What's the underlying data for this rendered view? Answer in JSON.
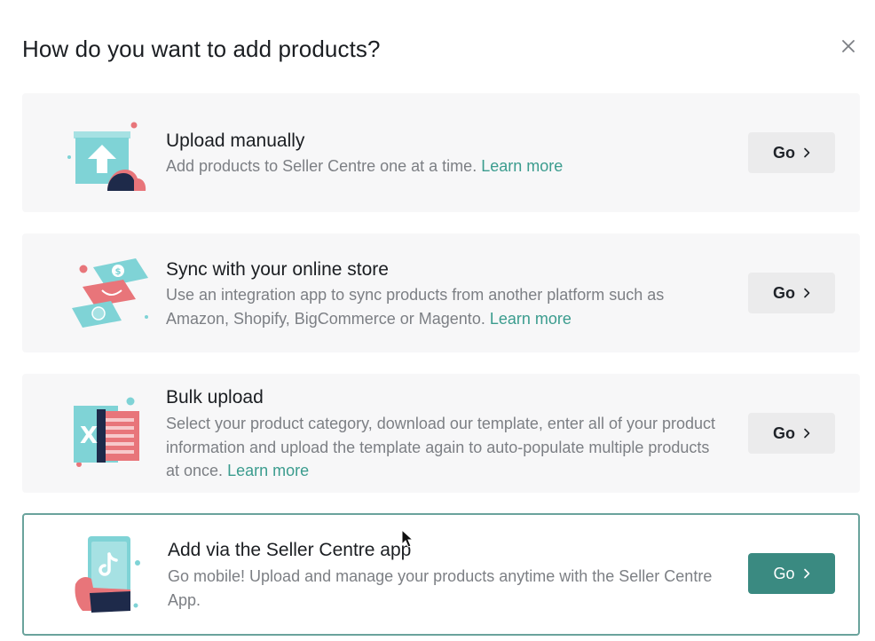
{
  "dialog": {
    "title": "How do you want to add products?",
    "close_icon": "close-icon"
  },
  "options": [
    {
      "title": "Upload manually",
      "description": "Add products to Seller Centre one at a time.",
      "link": "Learn more",
      "button": "Go",
      "icon": "upload-box-illustration"
    },
    {
      "title": "Sync with your online store",
      "description": "Use an integration app to sync products from another platform such as Amazon, Shopify, BigCommerce or Magento.",
      "link": "Learn more",
      "button": "Go",
      "icon": "sync-store-illustration"
    },
    {
      "title": "Bulk upload",
      "description": "Select your product category, download our template, enter all of your product information and upload the template again to auto-populate multiple products at once.",
      "link": "Learn more",
      "button": "Go",
      "icon": "spreadsheet-illustration"
    },
    {
      "title": "Add via the Seller Centre app",
      "description": "Go mobile! Upload and manage your products anytime with the Seller Centre App.",
      "link": "",
      "button": "Go",
      "icon": "mobile-app-illustration",
      "selected": true
    }
  ],
  "colors": {
    "accent": "#3a8a81",
    "link": "#3b9c8e",
    "card_bg": "#f7f7f8",
    "selected_border": "#6aa39c",
    "illustration_teal": "#7fd3d6",
    "illustration_navy": "#1e2a4a",
    "illustration_coral": "#e8757a"
  }
}
